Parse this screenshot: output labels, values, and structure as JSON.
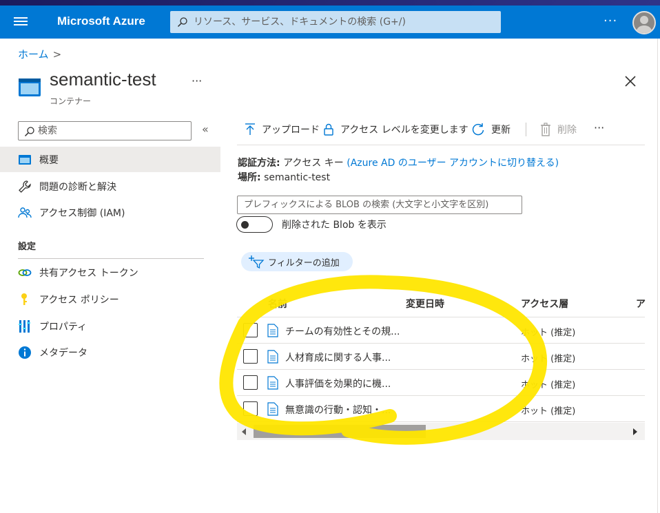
{
  "topbar": {
    "brand": "Microsoft Azure",
    "search_placeholder": "リソース、サービス、ドキュメントの検索 (G+/)",
    "more_label": "···",
    "accent_color": "#0078d4"
  },
  "breadcrumb": {
    "home": "ホーム",
    "chevron": ">"
  },
  "header": {
    "title": "semantic-test",
    "subtitle": "コンテナー",
    "more_label": "···"
  },
  "sidebar": {
    "search_placeholder": "検索",
    "collapse_label": "«",
    "items": [
      {
        "label": "概要",
        "icon": "overview-icon",
        "active": true
      },
      {
        "label": "問題の診断と解決",
        "icon": "wrench-icon"
      },
      {
        "label": "アクセス制御 (IAM)",
        "icon": "people-icon"
      }
    ],
    "section_label": "設定",
    "settings_items": [
      {
        "label": "共有アクセス トークン",
        "icon": "link-icon"
      },
      {
        "label": "アクセス ポリシー",
        "icon": "key-icon"
      },
      {
        "label": "プロパティ",
        "icon": "properties-icon"
      },
      {
        "label": "メタデータ",
        "icon": "info-icon"
      }
    ]
  },
  "commands": {
    "upload": "アップロード",
    "change_access": "アクセス レベルを変更します",
    "refresh": "更新",
    "delete": "削除",
    "more": "···"
  },
  "auth": {
    "label": "認証方法:",
    "value": "アクセス キー",
    "switch_link": "(Azure AD のユーザー アカウントに切り替える)"
  },
  "location": {
    "label": "場所:",
    "value": "semantic-test"
  },
  "blob_search": {
    "placeholder": "プレフィックスによる BLOB の検索 (大文字と小文字を区別)"
  },
  "show_deleted": {
    "label": "削除された Blob を表示",
    "on": false
  },
  "filter": {
    "label": "フィルターの追加"
  },
  "table": {
    "columns": [
      "名前",
      "変更日時",
      "アクセス層",
      "ア"
    ],
    "rows": [
      {
        "name": "チームの有効性とその規...",
        "modified": "",
        "tier": "ホット (推定)"
      },
      {
        "name": "人材育成に関する人事...",
        "modified": "",
        "tier": "ホット (推定)"
      },
      {
        "name": "人事評価を効果的に機...",
        "modified": "",
        "tier": "ホット (推定)"
      },
      {
        "name": "無意識の行動・認知・...",
        "modified": "",
        "tier": "ホット (推定)"
      }
    ]
  },
  "annotation": {
    "color": "#ffe600"
  }
}
